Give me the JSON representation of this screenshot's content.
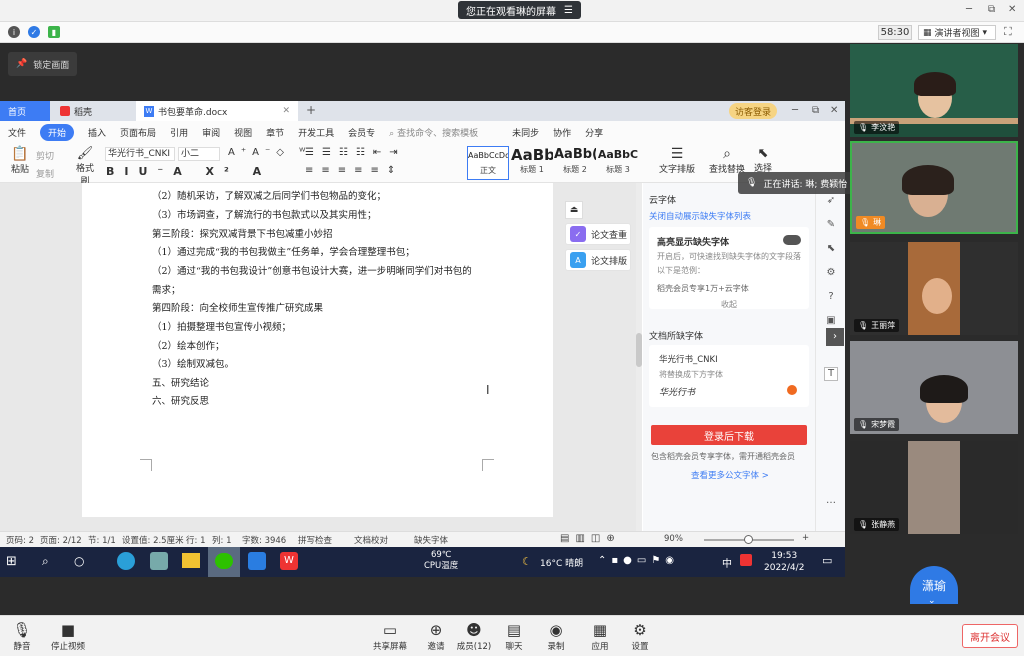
{
  "window": {
    "share_notice": "您正在观看琳的屏幕",
    "min": "─",
    "restore": "⧉",
    "close": "✕"
  },
  "infobar": {
    "timer": "58:30",
    "view_mode": "演讲者视图",
    "lock_label": "锁定画面"
  },
  "wps": {
    "tabs": {
      "home": "首页",
      "daoke": "稻壳",
      "doc": "书包要革命.docx",
      "visitor": "访客登录"
    },
    "menu": [
      "文件",
      "开始",
      "插入",
      "页面布局",
      "引用",
      "审阅",
      "视图",
      "章节",
      "开发工具",
      "会员专"
    ],
    "menu_search": "查找命令、搜索模板",
    "menu_right": [
      "未同步",
      "协作",
      "分享"
    ],
    "ribbon": {
      "paste": "粘贴",
      "cut": "剪切",
      "copy": "复制",
      "format_painter": "格式刷",
      "font_name": "华光行书_CNKI",
      "font_size": "小二",
      "styles": [
        {
          "preview": "AaBbCcDd",
          "label": "正文"
        },
        {
          "preview": "AaBb",
          "label": "标题 1"
        },
        {
          "preview": "AaBb(",
          "label": "标题 2"
        },
        {
          "preview": "AaBbC",
          "label": "标题 3"
        }
      ],
      "text_layout": "文字排版",
      "find_replace": "查找替换",
      "select": "选择"
    },
    "doc_lines": [
      "（2）随机采访，了解双减之后同学们书包物品的变化；",
      "（3）市场调查，了解流行的书包款式以及其实用性；",
      "第三阶段：探究双减背景下书包减重小妙招",
      "（1）通过完成“我的书包我做主”任务单，学会合理整理书包；",
      "（2）通过“我的书包我设计”创意书包设计大赛，进一步明晰同学们对书包的",
      "需求；",
      "第四阶段：向全校师生宣传推广研究成果",
      "（1）拍摄整理书包宣传小视频；",
      "（2）绘本创作；",
      "（3）绘制双减包。",
      "五、研究结论",
      "六、研究反思"
    ],
    "side_buttons": [
      "论文查重",
      "论文排版"
    ],
    "font_pane": {
      "title": "云字体",
      "link": "关闭自动展示缺失字体列表",
      "highlight_title": "高亮显示缺失字体",
      "highlight_desc": "开启后，可快速找到缺失字体的文字段落",
      "example": "以下是范例：",
      "member_note": "稻壳会员专享1万+云字体",
      "collapse": "收起",
      "missing_title": "文档所缺字体",
      "missing_font": "华光行书_CNKI",
      "replace_hint": "将替换成下方字体",
      "preview": "华光行书",
      "download": "登录后下载",
      "note": "包含稻壳会员专享字体，需开通稻壳会员",
      "more": "查看更多公文字体 >"
    },
    "status": {
      "page_code": "页码: 2",
      "pages": "页面: 2/12",
      "section": "节: 1/1",
      "setting": "设置值: 2.5厘米",
      "row": "行: 1",
      "col": "列: 1",
      "words": "字数: 3946",
      "spell": "拼写检查",
      "proof": "文档校对",
      "missing": "缺失字体",
      "zoom": "90%"
    }
  },
  "taskbar": {
    "cpu_temp": "69℃",
    "cpu_label": "CPU温度",
    "weather": "16°C 晴朗",
    "ime": "中",
    "time": "19:53",
    "date": "2022/4/2"
  },
  "participants": [
    {
      "name": "李汶艳"
    },
    {
      "name": "琳"
    },
    {
      "name": "王丽萍"
    },
    {
      "name": "宋梦霞"
    },
    {
      "name": "张静燕"
    }
  ],
  "speaking": "正在讲话: 琳; 费颖怡",
  "self_avatar": "潇瑜",
  "bottom": {
    "mute": "静音",
    "stop_video": "停止视频",
    "share": "共享屏幕",
    "invite": "邀请",
    "members": "成员(12)",
    "chat": "聊天",
    "record": "录制",
    "apps": "应用",
    "settings": "设置",
    "leave": "离开会议"
  },
  "colors": {
    "accent": "#3d7cf4",
    "download": "#e9423a",
    "taskbar": "#1a2440"
  }
}
